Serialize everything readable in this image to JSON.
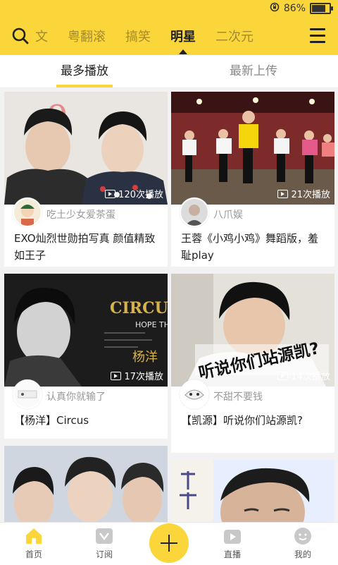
{
  "status_bar": {
    "battery": "86%",
    "icons": [
      "screen-rotation-lock-icon",
      "battery-icon"
    ]
  },
  "top_nav": {
    "categories": [
      "文",
      "粤翻滚",
      "搞笑",
      "明星",
      "二次元"
    ],
    "active_index": 3,
    "icons": [
      "search-icon",
      "menu-icon"
    ]
  },
  "sub_tabs": {
    "items": [
      "最多播放",
      "最新上传"
    ],
    "active_index": 0
  },
  "cards": [
    {
      "plays": "120次播放",
      "author": "吃土少女爱茶蛋",
      "title": "EXO灿烈世勋拍写真 颜值精致如王子"
    },
    {
      "plays": "21次播放",
      "author": "八爪娱",
      "title": "王蓉《小鸡小鸡》舞蹈版，羞耻play"
    },
    {
      "plays": "17次播放",
      "author": "认真你就输了",
      "title": "【杨洋】Circus"
    },
    {
      "plays": "14次播放",
      "author": "不甜不要钱",
      "title": "【凯源】听说你们站源凯?"
    }
  ],
  "thumb_text": {
    "card3_sign": "CIRCUS",
    "card3_hope": "HOPE TH",
    "card3_name": "杨洋",
    "card4_caption": "听说你们站源凯?"
  },
  "bottom_nav": {
    "items": [
      "首页",
      "订阅",
      "直播",
      "我的"
    ],
    "icons": [
      "home-icon",
      "subscribe-icon",
      "add-icon",
      "live-icon",
      "profile-icon"
    ],
    "active_index": 0
  },
  "colors": {
    "accent": "#fbd63a",
    "active_text": "#222222",
    "muted_text": "#999999"
  }
}
